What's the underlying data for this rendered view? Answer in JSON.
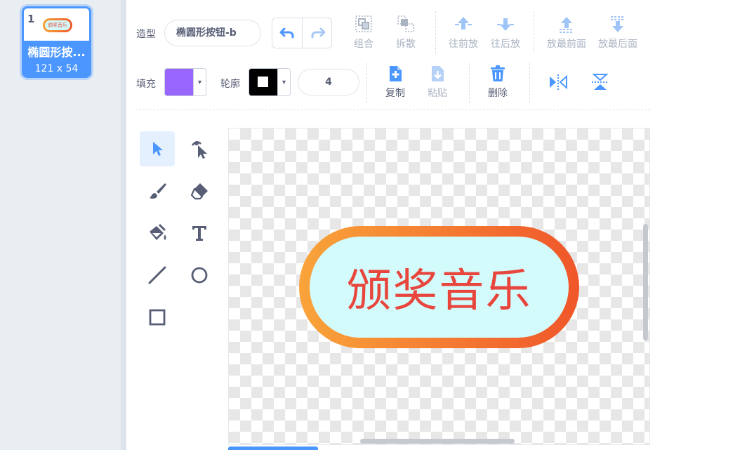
{
  "costume_list": {
    "items": [
      {
        "index": "1",
        "name": "椭圆形按...",
        "size": "121 x 54",
        "thumb_text": "颁奖音乐"
      }
    ]
  },
  "toolbar": {
    "costume_label": "造型",
    "costume_name": "椭圆形按钮-b",
    "group_label": "组合",
    "ungroup_label": "拆散",
    "forward_label": "往前放",
    "backward_label": "往后放",
    "front_label": "放最前面",
    "back_label": "放最后面",
    "fill_label": "填充",
    "outline_label": "轮廓",
    "outline_width": "4",
    "copy_label": "复制",
    "paste_label": "粘贴",
    "delete_label": "删除"
  },
  "colors": {
    "accent": "#4c97ff",
    "fill_swatch": "#9966ff",
    "outline_swatch": "#000000",
    "button_gradient_start": "#f9a43a",
    "button_gradient_end": "#f0562a",
    "button_inner": "#d4fbfc",
    "button_text": "#e8453c"
  },
  "tools": [
    "select-tool",
    "reshape-tool",
    "brush-tool",
    "eraser-tool",
    "fill-tool",
    "text-tool",
    "line-tool",
    "circle-tool",
    "rect-tool"
  ],
  "canvas": {
    "button_text": "颁奖音乐"
  }
}
